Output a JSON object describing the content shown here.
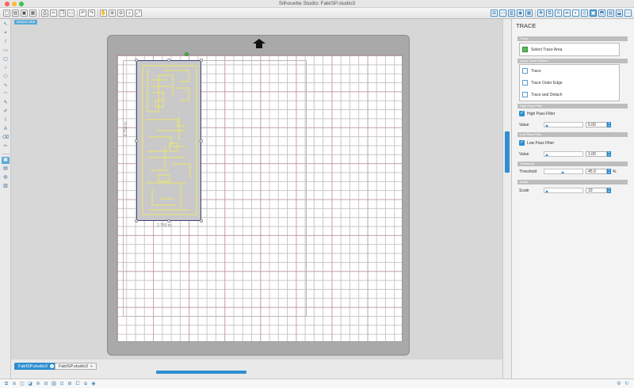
{
  "window": {
    "title": "Silhouette Studio: FabISP.studio3",
    "controls": [
      {
        "name": "close",
        "color": "#fc605c"
      },
      {
        "name": "minimize",
        "color": "#fdbc40"
      },
      {
        "name": "zoom",
        "color": "#34c84a"
      }
    ]
  },
  "toolbar": {
    "left_icons": [
      "new-document-icon",
      "open-folder-icon",
      "save-icon",
      "library-icon",
      "print-icon",
      "cut-icon",
      "copy-icon",
      "paste-icon",
      "undo-icon",
      "redo-icon",
      "pan-icon",
      "zoom-in-icon",
      "zoom-out-icon",
      "zoom-select-icon",
      "fit-to-page-icon"
    ],
    "left_glyphs": [
      "▢",
      "▤",
      "▣",
      "▦",
      "⎙",
      "✂",
      "❐",
      "▭",
      "↶",
      "↷",
      "✋",
      "⊕",
      "⊖",
      "⌕",
      "⤢"
    ],
    "right_icons": [
      "grid-icon",
      "page-setup-icon",
      "cut-settings-icon",
      "fill-icon",
      "line-color-icon",
      "transform-icon",
      "replicate-icon",
      "text-style-icon",
      "align-icon",
      "modify-icon",
      "offset-icon",
      "trace-icon",
      "store-icon",
      "send-icon",
      "eraser-icon",
      "knife-icon"
    ],
    "right_glyphs": [
      "⊞",
      "▭",
      "▥",
      "◉",
      "▦",
      "✥",
      "⧉",
      "A",
      "⇹",
      "◐",
      "◎",
      "▣",
      "⬒",
      "▤",
      "⬓",
      "▱"
    ],
    "active_right_icon": "trace-icon"
  },
  "left_tools": {
    "icons": [
      "select-tool-icon",
      "edit-points-icon",
      "line-tool-icon",
      "rectangle-tool-icon",
      "rounded-rect-tool-icon",
      "ellipse-tool-icon",
      "polygon-tool-icon",
      "curve-tool-icon",
      "arc-tool-icon",
      "freehand-tool-icon",
      "smooth-freehand-icon",
      "polyline-icon",
      "text-tool-icon",
      "eraser-tool-icon",
      "knife-tool-icon",
      "view-design-area-icon",
      "view-library-icon",
      "online-store-icon",
      "send-panel-icon"
    ],
    "glyphs": [
      "↖",
      "⌖",
      "/",
      "▭",
      "▢",
      "○",
      "⬠",
      "∿",
      "◠",
      "✎",
      "✐",
      "⌇",
      "A",
      "⌫",
      "✂",
      "▣",
      "▤",
      "◍",
      "▥"
    ],
    "active_icon": "view-design-area-icon"
  },
  "canvas": {
    "view_label": "DESIGN VIEW",
    "dimension_vertical": "6.750 in",
    "dimension_horizontal": "2.750 in"
  },
  "tabs": {
    "documents": [
      {
        "label": "FabISP.studio3",
        "active": true
      },
      {
        "label": "FabISP.studio3",
        "active": false
      }
    ],
    "close_glyph": "×",
    "add_glyph": "+"
  },
  "panel": {
    "title": "TRACE",
    "trace_section": {
      "header": "Trace",
      "select_trace_area_label": "Select Trace Area"
    },
    "method_section": {
      "header": "Apply Trace Method",
      "options": [
        "Trace",
        "Trace Outer Edge",
        "Trace and Detach"
      ]
    },
    "high_pass": {
      "header": "High Pass Filter",
      "checkbox_label": "High Pass Filter",
      "checked": true,
      "value_label": "Value",
      "value": "5.00",
      "slider_fraction": 0.02
    },
    "low_pass": {
      "header": "Low Pass Filter",
      "checkbox_label": "Low Pass Filter",
      "checked": true,
      "value_label": "Value",
      "value": "1.00",
      "slider_fraction": 0.02
    },
    "threshold": {
      "header": "Threshold",
      "label": "Threshold",
      "value": "45.0",
      "unit": "%",
      "slider_fraction": 0.45
    },
    "scale": {
      "header": "Scale",
      "label": "Scale",
      "value": "10",
      "slider_fraction": 0.02
    }
  },
  "statusbar": {
    "left_icons": [
      "group-icon",
      "ungroup-icon",
      "compound-path-icon",
      "release-compound-icon",
      "weld-icon",
      "subtract-icon",
      "intersect-icon",
      "align-center-icon",
      "align-middle-icon",
      "bring-front-icon",
      "send-back-icon",
      "settings-circle-icon"
    ],
    "left_glyphs": [
      "⧉",
      "⧈",
      "◫",
      "◪",
      "⊛",
      "⊟",
      "⨂",
      "⊡",
      "⊞",
      "⧠",
      "⧇",
      "◉"
    ],
    "right_icons": [
      "preferences-gear-icon",
      "sync-icon"
    ],
    "right_glyphs": [
      "⚙",
      "↻"
    ]
  }
}
